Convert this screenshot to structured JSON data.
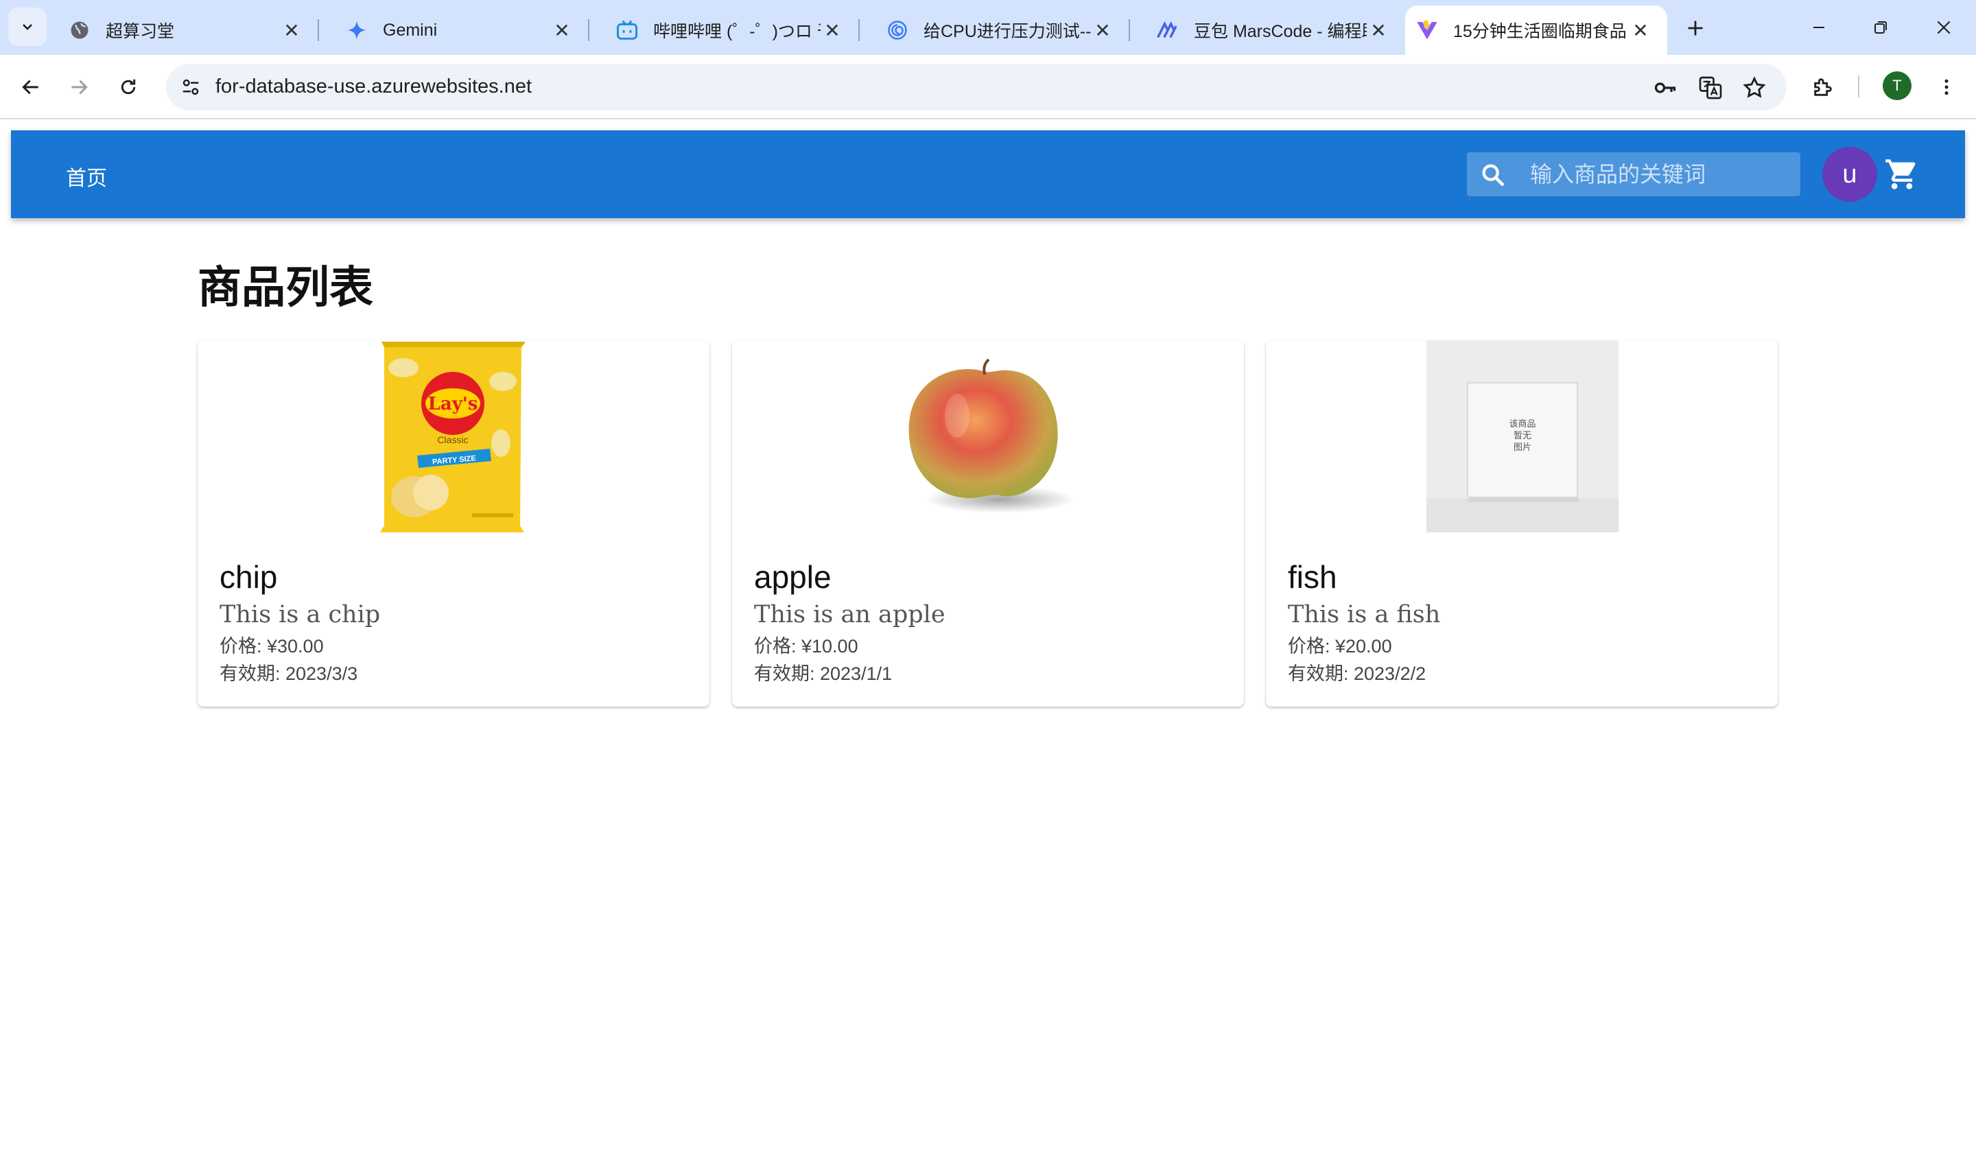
{
  "browser": {
    "tabs": [
      {
        "title": "超算习堂",
        "icon": "globe-icon"
      },
      {
        "title": "Gemini",
        "icon": "gemini-sparkle-icon"
      },
      {
        "title": "哔哩哔哩 (゜-゜)つロ 干",
        "icon": "bilibili-tv-icon"
      },
      {
        "title": "给CPU进行压力测试---",
        "icon": "swirl-icon"
      },
      {
        "title": "豆包 MarsCode - 编程助",
        "icon": "marscode-icon"
      },
      {
        "title": "15分钟生活圈临期食品",
        "icon": "vite-logo-icon",
        "active": true
      }
    ],
    "url": "for-database-use.azurewebsites.net",
    "profile_initial": "T"
  },
  "appbar": {
    "home_label": "首页",
    "search_placeholder": "输入商品的关键词",
    "avatar_initial": "u",
    "color": "#1976d2",
    "avatar_color": "#673ab7"
  },
  "page": {
    "title": "商品列表"
  },
  "products": [
    {
      "name": "chip",
      "description": "This is a chip",
      "price": "价格: ¥30.00",
      "expiry": "有效期: 2023/3/3",
      "image": "chips-bag-image",
      "brand_text": "Lay's",
      "bag_label": "Classic",
      "bag_banner": "PARTY SIZE"
    },
    {
      "name": "apple",
      "description": "This is an apple",
      "price": "价格: ¥10.00",
      "expiry": "有效期: 2023/1/1",
      "image": "apple-image"
    },
    {
      "name": "fish",
      "description": "This is a fish",
      "price": "价格: ¥20.00",
      "expiry": "有效期: 2023/2/2",
      "image": "no-image-placeholder",
      "placeholder_lines": [
        "该商品",
        "暂无",
        "图片"
      ]
    }
  ]
}
